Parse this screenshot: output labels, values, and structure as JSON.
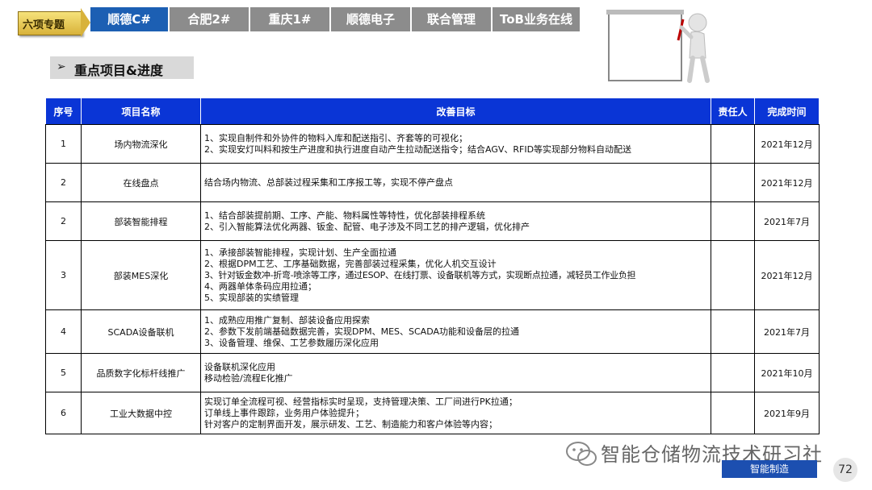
{
  "nav": {
    "section_label": "六项专题",
    "tabs": [
      {
        "label": "顺德C#",
        "active": true
      },
      {
        "label": "合肥2#",
        "active": false
      },
      {
        "label": "重庆1#",
        "active": false
      },
      {
        "label": "顺德电子",
        "active": false
      },
      {
        "label": "联合管理",
        "active": false
      },
      {
        "label": "ToB业务在线",
        "active": false
      }
    ]
  },
  "sub_header": {
    "bullet": "➢",
    "title": "重点项目&进度"
  },
  "table": {
    "headers": [
      "序号",
      "项目名称",
      "改善目标",
      "责任人",
      "完成时间"
    ],
    "rows": [
      {
        "no": "1",
        "name": "场内物流深化",
        "goals": [
          "1、实现自制件和外协件的物料入库和配送指引、齐套等的可视化；",
          "2、实现安灯叫料和按生产进度和执行进度自动产生拉动配送指令；结合AGV、RFID等实现部分物料自动配送"
        ],
        "owner": "",
        "date": "2021年12月"
      },
      {
        "no": "2",
        "name": "在线盘点",
        "goals": [
          "结合场内物流、总部装过程采集和工序报工等，实现不停产盘点"
        ],
        "owner": "",
        "date": "2021年12月"
      },
      {
        "no": "2",
        "name": "部装智能排程",
        "goals": [
          "1、结合部装提前期、工序、产能、物料属性等特性，优化部装排程系统",
          "2、引入智能算法优化两器、钣金、配管、电子涉及不同工艺的排产逻辑，优化排产"
        ],
        "owner": "",
        "date": "2021年7月"
      },
      {
        "no": "3",
        "name": "部装MES深化",
        "goals": [
          "1、承接部装智能排程，实现计划、生产全面拉通",
          "2、根据DPM工艺、工序基础数据，完善部装过程采集，优化人机交互设计",
          "3、针对钣金数冲-折弯-喷涂等工序，通过ESOP、在线打票、设备联机等方式，实现断点拉通，减轻员工作业负担",
          "4、两器单体条码应用拉通；",
          "5、实现部装的实绩管理"
        ],
        "owner": "",
        "date": "2021年12月"
      },
      {
        "no": "4",
        "name": "SCADA设备联机",
        "goals": [
          "1、成熟应用推广复制、部装设备应用探索",
          "2、参数下发前端基础数据完善，实现DPM、MES、SCADA功能和设备层的拉通",
          "3、设备管理、维保、工艺参数履历深化应用"
        ],
        "owner": "",
        "date": "2021年7月"
      },
      {
        "no": "5",
        "name": "品质数字化标杆线推广",
        "goals": [
          "设备联机深化应用",
          "移动检验/流程E化推广"
        ],
        "owner": "",
        "date": "2021年10月"
      },
      {
        "no": "6",
        "name": "工业大数据中控",
        "goals": [
          "实现订单全流程可视、经营指标实时呈现，支持管理决策、工厂间进行PK拉通；",
          "订单线上事件跟踪，业务用户体验提升；",
          "针对客户的定制界面开发，展示研发、工艺、制造能力和客户体验等内容；"
        ],
        "owner": "",
        "date": "2021年9月"
      }
    ]
  },
  "footer": {
    "watermark": "智能仓储物流技术研习社",
    "badge": "智能制造",
    "page_number": "72"
  },
  "colors": {
    "header_blue": "#0a35d6",
    "active_tab": "#1c5fb3",
    "inactive_tab": "#8c8c8c"
  }
}
